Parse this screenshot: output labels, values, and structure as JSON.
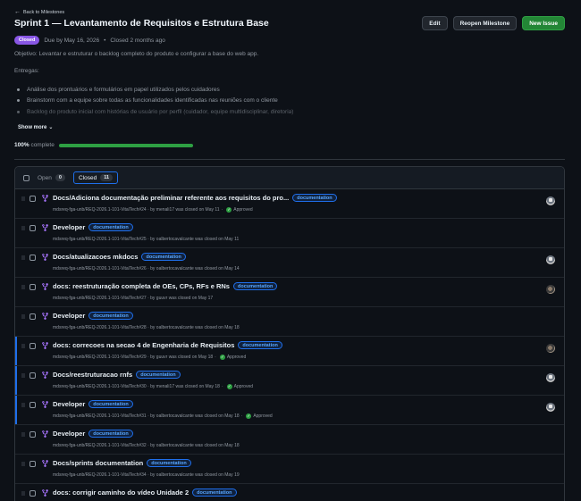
{
  "back_label": "Back to Milestones",
  "title": "Sprint 1 — Levantamento de Requisitos e Estrutura Base",
  "actions": {
    "edit": "Edit",
    "reopen": "Reopen Milestone",
    "new_issue": "New Issue"
  },
  "status_badge": "Closed",
  "due": "Due by May 16, 2026",
  "closed_ago": "Closed 2 months ago",
  "objective": "Objetivo: Levantar e estruturar o backlog completo do produto e configurar a base do web app.",
  "entregas_label": "Entregas:",
  "bullets": [
    "Análise dos prontuários e formulários em papel utilizados pelos cuidadores",
    "Brainstorm com a equipe sobre todas as funcionalidades identificadas nas reuniões com o cliente",
    "Backlog do produto inicial com histórias de usuário por perfil (cuidador, equipe multidisciplinar, diretoria)"
  ],
  "show_more": "Show more",
  "progress": {
    "percent_label": "100%",
    "suffix": "complete",
    "fraction": 1.0
  },
  "filters": {
    "open_label": "Open",
    "open_count": "0",
    "closed_label": "Closed",
    "closed_count": "11"
  },
  "colors": {
    "merged": "#a371f7",
    "label": "#58a6ff",
    "success": "#2ea043",
    "accent": "#1f6feb"
  },
  "items": [
    {
      "title": "Docs/Adiciona documentação preliminar referente aos requisitos do pro...",
      "label": "documentation",
      "sub": "mdsreq-fga-unb/REQ-2026.1-101-VitalTech#24 · by menali17 was closed on May 11",
      "status": "Approved",
      "avatar": true,
      "dark": false,
      "hl": false
    },
    {
      "title": "Developer",
      "label": "documentation",
      "sub": "mdsreq-fga-unb/REQ-2026.1-101-VitalTech#25 · by oalbertocavalcante was closed on May 11",
      "status": "",
      "avatar": false,
      "dark": false,
      "hl": false
    },
    {
      "title": "Docs/atualizacoes mkdocs",
      "label": "documentation",
      "sub": "mdsreq-fga-unb/REQ-2026.1-101-VitalTech#26 · by oalbertocavalcante was closed on May 14",
      "status": "",
      "avatar": true,
      "dark": false,
      "hl": false
    },
    {
      "title": "docs: reestruturação completa de OEs, CPs, RFs e RNs",
      "label": "documentation",
      "sub": "mdsreq-fga-unb/REQ-2026.1-101-VitalTech#27 · by guuvr was closed on May 17",
      "status": "",
      "avatar": true,
      "dark": true,
      "hl": false
    },
    {
      "title": "Developer",
      "label": "documentation",
      "sub": "mdsreq-fga-unb/REQ-2026.1-101-VitalTech#28 · by oalbertocavalcante was closed on May 18",
      "status": "",
      "avatar": false,
      "dark": false,
      "hl": false
    },
    {
      "title": "docs: correcoes na secao 4 de Engenharia de Requisitos",
      "label": "documentation",
      "sub": "mdsreq-fga-unb/REQ-2026.1-101-VitalTech#29 · by guuvr was closed on May 18",
      "status": "Approved",
      "avatar": true,
      "dark": true,
      "hl": true
    },
    {
      "title": "Docs/reestruturacao rnfs",
      "label": "documentation",
      "sub": "mdsreq-fga-unb/REQ-2026.1-101-VitalTech#30 · by menali17 was closed on May 18",
      "status": "Approved",
      "avatar": true,
      "dark": false,
      "hl": true
    },
    {
      "title": "Developer",
      "label": "documentation",
      "sub": "mdsreq-fga-unb/REQ-2026.1-101-VitalTech#31 · by oalbertocavalcante was closed on May 18",
      "status": "Approved",
      "avatar": true,
      "dark": false,
      "hl": true
    },
    {
      "title": "Developer",
      "label": "documentation",
      "sub": "mdsreq-fga-unb/REQ-2026.1-101-VitalTech#32 · by oalbertocavalcante was closed on May 18",
      "status": "",
      "avatar": false,
      "dark": false,
      "hl": false
    },
    {
      "title": "Docs/sprints documentation",
      "label": "documentation",
      "sub": "mdsreq-fga-unb/REQ-2026.1-101-VitalTech#34 · by oalbertocavalcante was closed on May 19",
      "status": "",
      "avatar": false,
      "dark": false,
      "hl": false
    },
    {
      "title": "docs: corrigir caminho do vídeo Unidade 2",
      "label": "documentation",
      "sub": "",
      "status": "",
      "avatar": false,
      "dark": false,
      "hl": false
    }
  ]
}
